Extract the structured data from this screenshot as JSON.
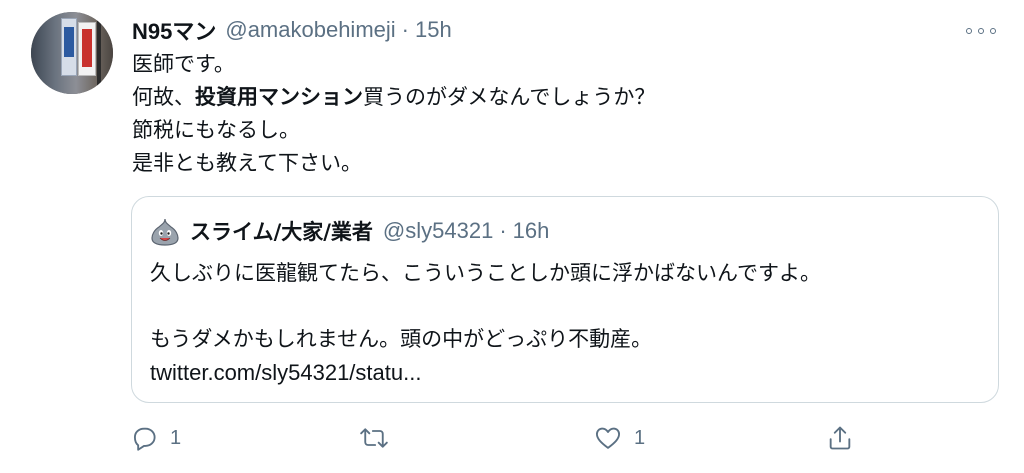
{
  "tweet": {
    "display_name": "N95マン",
    "handle": "@amakobehimeji",
    "separator": "·",
    "time": "15h",
    "lines": {
      "l1": "医師です。",
      "l2_pre": "何故、",
      "l2_bold": "投資用マンション",
      "l2_post": "買うのがダメなんでしょうか？",
      "l3": "節税にもなるし。",
      "l4": "是非とも教えて下さい。"
    }
  },
  "quote": {
    "display_name": "スライム/大家/業者",
    "handle": "@sly54321",
    "separator": "·",
    "time": "16h",
    "line1": "久しぶりに医龍観てたら、こういうことしか頭に浮かばないんですよ。",
    "line2": "もうダメかもしれません。頭の中がどっぷり不動産。",
    "link": "twitter.com/sly54321/statu..."
  },
  "actions": {
    "reply_count": "1",
    "like_count": "1"
  },
  "icons": {
    "more": "more-horizontal-icon",
    "reply": "reply-icon",
    "retweet": "retweet-icon",
    "like": "heart-icon",
    "share": "share-icon"
  },
  "colors": {
    "text": "#0f1419",
    "secondary": "#5b7083",
    "border": "#cfd9de"
  }
}
